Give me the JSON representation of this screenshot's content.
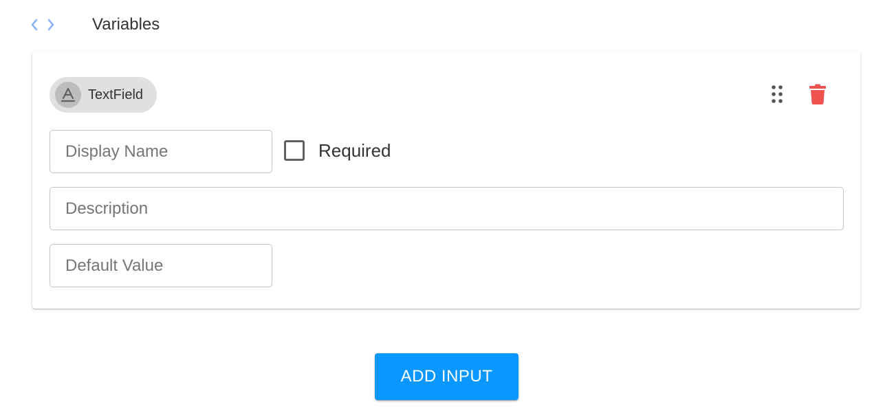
{
  "header": {
    "icon": "code-icon",
    "title": "Variables"
  },
  "card": {
    "chip": {
      "icon": "text-field-icon",
      "label": "TextField"
    },
    "actions": {
      "drag_icon": "drag-handle-icon",
      "delete_icon": "trash-icon"
    },
    "fields": {
      "display_name": {
        "placeholder": "Display Name",
        "value": ""
      },
      "description": {
        "placeholder": "Description",
        "value": ""
      },
      "default_value": {
        "placeholder": "Default Value",
        "value": ""
      }
    },
    "required": {
      "label": "Required",
      "checked": false
    }
  },
  "add_button": {
    "label": "ADD INPUT"
  },
  "colors": {
    "accent": "#0a97ff",
    "code_icon": "#8ab4f8",
    "delete": "#ef5350",
    "chip_bg": "#e0e0e0"
  }
}
